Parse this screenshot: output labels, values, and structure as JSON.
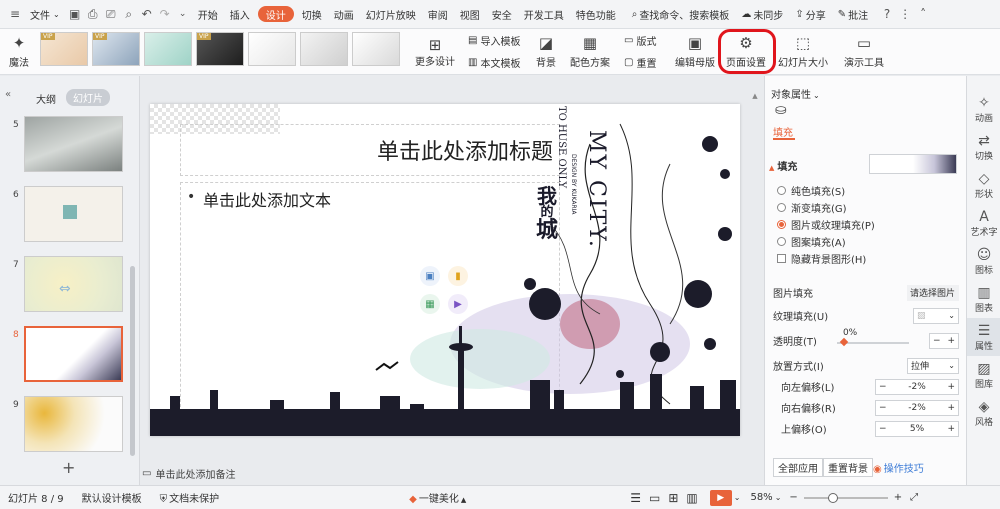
{
  "menu": {
    "file": "文件",
    "tabs": [
      "开始",
      "插入",
      "设计",
      "切换",
      "动画",
      "幻灯片放映",
      "审阅",
      "视图",
      "安全",
      "开发工具",
      "特色功能"
    ],
    "active_tab": "设计",
    "search": "查找命令、搜索模板",
    "sync": "未同步",
    "share": "分享",
    "comment": "批注"
  },
  "ribbon": {
    "magic": "魔法",
    "more_design": "更多设计",
    "import_template": "导入模板",
    "this_template": "本文模板",
    "background": "背景",
    "color_scheme": "配色方案",
    "layout": "版式",
    "reset": "重置",
    "edit_master": "编辑母版",
    "page_setup": "页面设置",
    "slide_size": "幻灯片大小",
    "presenter_tools": "演示工具",
    "vip": "VIP"
  },
  "left_panel": {
    "tab_outline": "大纲",
    "tab_slides": "幻灯片",
    "slide_numbers": [
      "5",
      "6",
      "7",
      "8",
      "9"
    ],
    "selected": "8",
    "add": "+"
  },
  "slide": {
    "title_placeholder": "单击此处添加标题",
    "body_placeholder": "单击此处添加文本",
    "art_en_title": "MY CITY.",
    "art_en_line1": "TO HUSE ONLY",
    "art_en_line2": "DESIGN BY KUKARIA",
    "art_cn": [
      "我",
      "的",
      "城"
    ]
  },
  "notes": {
    "placeholder": "单击此处添加备注"
  },
  "right_panel": {
    "header": "对象属性",
    "fill_tab": "填充",
    "fill_section": "填充",
    "options": [
      "纯色填充(S)",
      "渐变填充(G)",
      "图片或纹理填充(P)",
      "图案填充(A)"
    ],
    "selected_option": "图片或纹理填充(P)",
    "hide_bg": "隐藏背景图形(H)",
    "picture_fill_label": "图片填充",
    "picture_fill_value": "请选择图片",
    "texture_fill_label": "纹理填充(U)",
    "transparency_label": "透明度(T)",
    "transparency_value": "0%",
    "placement_label": "放置方式(I)",
    "placement_value": "拉伸",
    "offset_left_label": "向左偏移(L)",
    "offset_left_value": "-2%",
    "offset_right_label": "向右偏移(R)",
    "offset_right_value": "-2%",
    "offset_top_label": "上偏移(O)",
    "offset_top_value": "5%",
    "apply_all": "全部应用",
    "reset_bg": "重置背景",
    "tips": "操作技巧"
  },
  "toolstrip": [
    "动画",
    "切换",
    "形状",
    "艺术字",
    "图标",
    "图表",
    "属性",
    "图库",
    "风格"
  ],
  "toolstrip_active": "属性",
  "status": {
    "slide_info": "幻灯片 8 / 9",
    "template": "默认设计模板",
    "protect": "文档未保护",
    "beautify": "一键美化",
    "zoom": "58%"
  },
  "colors": {
    "accent": "#e8633a",
    "highlight_ring": "#e0151c"
  }
}
